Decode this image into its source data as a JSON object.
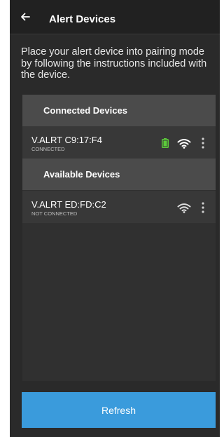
{
  "app": {
    "title": "Alert Devices",
    "back_icon": "arrow-left-icon"
  },
  "instructions": "Place your alert device into pairing mode by following the instructions included with the device.",
  "connected_section": {
    "label": "Connected Devices",
    "devices": [
      {
        "name": "V.ALRT C9:17:F4",
        "status": "CONNECTED",
        "battery_icon": "battery-full-icon",
        "battery_color": "#5ccb3a",
        "signal_icon": "wifi-signal-icon",
        "signal_color": "#ffffff"
      }
    ]
  },
  "available_section": {
    "label": "Available Devices",
    "devices": [
      {
        "name": "V.ALRT ED:FD:C2",
        "status": "NOT CONNECTED",
        "signal_icon": "wifi-signal-icon",
        "signal_color": "#dcdcdc"
      }
    ]
  },
  "refresh_label": "Refresh",
  "colors": {
    "accent": "#3a9bdc",
    "background": "#2a2a2a",
    "section_header": "#4b4b4b"
  }
}
